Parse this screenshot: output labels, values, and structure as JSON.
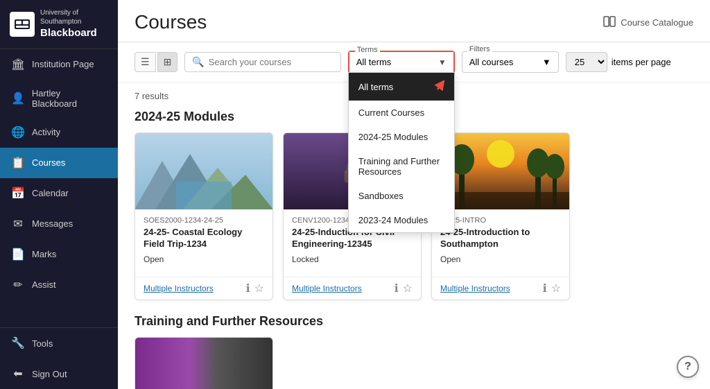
{
  "sidebar": {
    "logo": {
      "university": "University of",
      "name": "Southampton",
      "brand": "Blackboard"
    },
    "items": [
      {
        "id": "institution-page",
        "label": "Institution Page",
        "icon": "🏛",
        "active": false
      },
      {
        "id": "hartley-blackboard",
        "label": "Hartley Blackboard",
        "icon": "👤",
        "active": false
      },
      {
        "id": "activity",
        "label": "Activity",
        "icon": "🌐",
        "active": false
      },
      {
        "id": "courses",
        "label": "Courses",
        "icon": "📋",
        "active": true
      },
      {
        "id": "calendar",
        "label": "Calendar",
        "icon": "📅",
        "active": false
      },
      {
        "id": "messages",
        "label": "Messages",
        "icon": "✉",
        "active": false
      },
      {
        "id": "marks",
        "label": "Marks",
        "icon": "📄",
        "active": false
      },
      {
        "id": "assist",
        "label": "Assist",
        "icon": "✏",
        "active": false
      }
    ],
    "bottom_items": [
      {
        "id": "tools",
        "label": "Tools",
        "icon": "🔧"
      },
      {
        "id": "sign-out",
        "label": "Sign Out",
        "icon": "⬅"
      }
    ]
  },
  "header": {
    "title": "Courses",
    "catalogue_label": "Course Catalogue"
  },
  "toolbar": {
    "search_placeholder": "Search your courses",
    "terms_label": "Terms",
    "terms_selected": "All terms",
    "filters_label": "Filters",
    "filters_selected": "All courses",
    "per_page_value": "25",
    "per_page_label": "items per page"
  },
  "dropdown": {
    "items": [
      {
        "id": "all-terms",
        "label": "All terms",
        "selected": true
      },
      {
        "id": "current-courses",
        "label": "Current Courses",
        "selected": false
      },
      {
        "id": "2024-25-modules",
        "label": "2024-25 Modules",
        "selected": false
      },
      {
        "id": "training",
        "label": "Training and Further Resources",
        "selected": false
      },
      {
        "id": "sandboxes",
        "label": "Sandboxes",
        "selected": false
      },
      {
        "id": "2023-24-modules",
        "label": "2023-24 Modules",
        "selected": false
      }
    ]
  },
  "results": {
    "count": "7 results",
    "section1_title": "2024-25 Modules",
    "section2_title": "Training and Further Resources"
  },
  "courses": [
    {
      "id": "coastal-ecology",
      "code": "SOES2000-1234-24-25",
      "title": "24-25- Coastal Ecology Field Trip-1234",
      "status": "Open",
      "instructor": "Multiple Instructors",
      "img_type": "mountains"
    },
    {
      "id": "civil-engineering",
      "code": "CENV1200-12345-24-25",
      "title": "24-25-Induction for Civil Engineering-12345",
      "status": "Locked",
      "instructor": "Multiple Instructors",
      "img_type": "locked"
    },
    {
      "id": "intro-southampton",
      "code": "24-25-INTRO",
      "title": "24-25-Introduction to Southampton",
      "status": "Open",
      "instructor": "Multiple Instructors",
      "img_type": "trees"
    }
  ]
}
